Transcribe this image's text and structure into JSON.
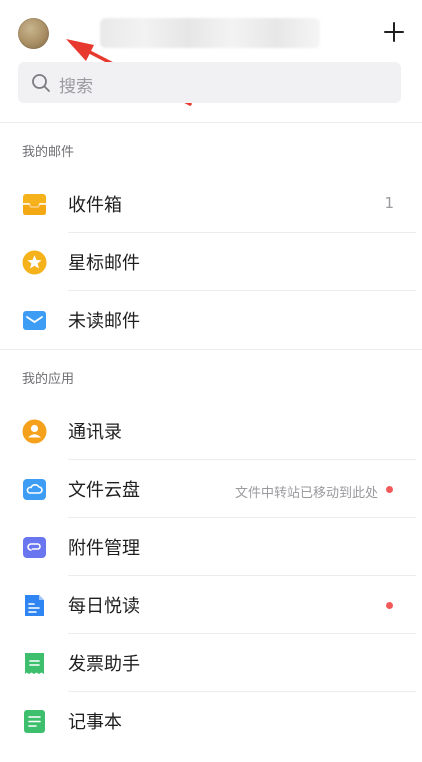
{
  "header": {
    "add_icon": "plus-icon"
  },
  "search": {
    "placeholder": "搜索",
    "icon": "search-icon"
  },
  "sections": [
    {
      "title": "我的邮件",
      "items": [
        {
          "label": "收件箱",
          "icon": "inbox-icon",
          "count": "1",
          "color": "#f5b21b"
        },
        {
          "label": "星标邮件",
          "icon": "star-icon",
          "color": "#f5b21b"
        },
        {
          "label": "未读邮件",
          "icon": "unread-mail-icon",
          "color": "#3d9cf3"
        }
      ]
    },
    {
      "title": "我的应用",
      "items": [
        {
          "label": "通讯录",
          "icon": "contacts-icon",
          "color": "#f5a11b"
        },
        {
          "label": "文件云盘",
          "icon": "cloud-drive-icon",
          "note": "文件中转站已移动到此处",
          "dot": true,
          "color": "#3d9cf3"
        },
        {
          "label": "附件管理",
          "icon": "attachment-icon",
          "color": "#6a76f0"
        },
        {
          "label": "每日悦读",
          "icon": "daily-reading-icon",
          "dot": true,
          "color": "#2f86f2"
        },
        {
          "label": "发票助手",
          "icon": "invoice-icon",
          "color": "#3dbf6e"
        },
        {
          "label": "记事本",
          "icon": "notepad-icon",
          "color": "#3dbf6e"
        }
      ]
    }
  ],
  "colors": {
    "accent_red": "#f25a5a",
    "annotation_arrow": "#e8392f"
  }
}
